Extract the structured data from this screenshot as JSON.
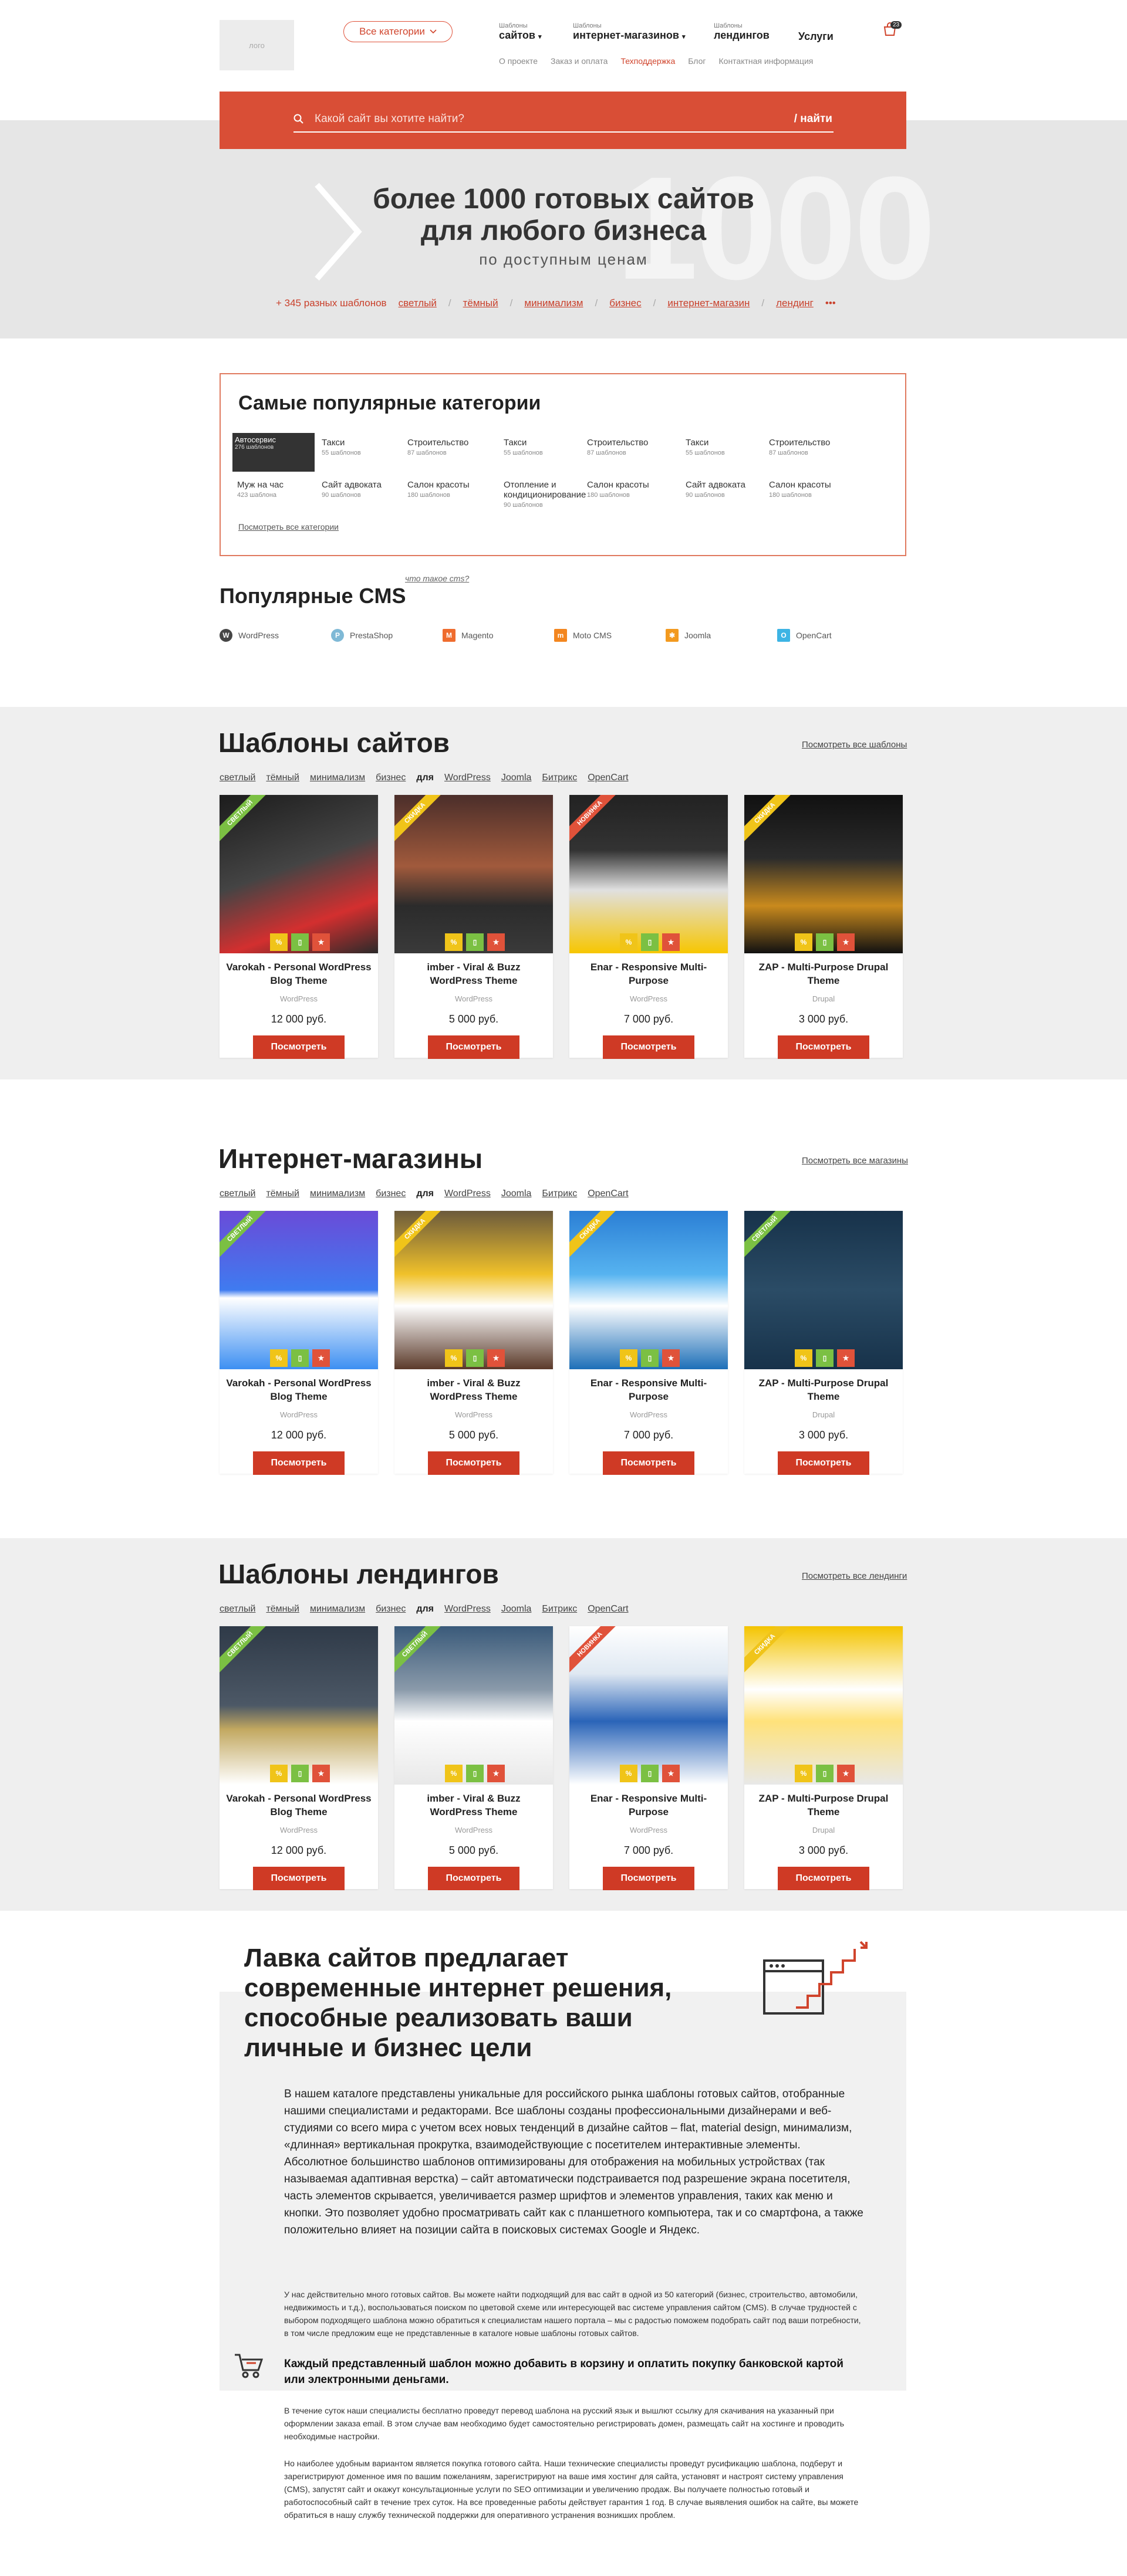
{
  "header": {
    "logo_text": "лого",
    "all_categories": "Все категории",
    "nav": [
      {
        "small": "Шаблоны",
        "big": "сайтов"
      },
      {
        "small": "Шаблоны",
        "big": "интернет-магазинов"
      },
      {
        "small": "Шаблоны",
        "big": "лендингов"
      },
      {
        "small": "",
        "big": "Услуги"
      }
    ],
    "cart_count": "23",
    "subnav": [
      "О проекте",
      "Заказ и оплата",
      "Техподдержка",
      "Блог",
      "Контактная информация"
    ]
  },
  "search": {
    "placeholder": "Какой сайт вы хотите найти?",
    "button": "/ найти"
  },
  "hero": {
    "bg_number": "1000",
    "title": "более 1000 готовых сайтов для любого бизнеса",
    "subtitle": "по доступным ценам",
    "count_link": "+ 345 разных шаблонов",
    "tags": [
      "светлый",
      "тёмный",
      "минимализм",
      "бизнес",
      "интернет-магазин",
      "лендинг"
    ],
    "more": "•••"
  },
  "popular": {
    "title": "Самые популярные категории",
    "thumb_label": "Автосервис",
    "thumb_count": "276 шаблонов",
    "items_row1": [
      {
        "name": "Такси",
        "count": "55 шаблонов"
      },
      {
        "name": "Строительство",
        "count": "87 шаблонов"
      },
      {
        "name": "Такси",
        "count": "55 шаблонов"
      },
      {
        "name": "Строительство",
        "count": "87 шаблонов"
      },
      {
        "name": "Такси",
        "count": "55 шаблонов"
      },
      {
        "name": "Строительство",
        "count": "87 шаблонов"
      }
    ],
    "items_row2": [
      {
        "name": "Муж на час",
        "count": "423 шаблона"
      },
      {
        "name": "Сайт адвоката",
        "count": "90 шаблонов"
      },
      {
        "name": "Салон красоты",
        "count": "180 шаблонов"
      },
      {
        "name": "Отопление и кондиционирование",
        "count": "90 шаблонов"
      },
      {
        "name": "Салон красоты",
        "count": "180 шаблонов"
      },
      {
        "name": "Сайт адвоката",
        "count": "90 шаблонов"
      },
      {
        "name": "Салон красоты",
        "count": "180 шаблонов"
      }
    ],
    "all_link": "Посмотреть все категории"
  },
  "cms": {
    "title": "Популярные CMS",
    "what": "что такое cms?",
    "items": [
      {
        "name": "WordPress",
        "icon": "wordpress-icon",
        "color": "#464646"
      },
      {
        "name": "PrestaShop",
        "icon": "prestashop-icon",
        "color": "#7fb9d6"
      },
      {
        "name": "Magento",
        "icon": "magento-icon",
        "color": "#ef6c2e"
      },
      {
        "name": "Moto CMS",
        "icon": "motocms-icon",
        "color": "#f3861f"
      },
      {
        "name": "Joomla",
        "icon": "joomla-icon",
        "color": "#f39a1f"
      },
      {
        "name": "OpenCart",
        "icon": "opencart-icon",
        "color": "#3db4e4"
      }
    ]
  },
  "filters": [
    "светлый",
    "тёмный",
    "минимализм",
    "бизнес"
  ],
  "filter_for": "для",
  "filter_cms": [
    "WordPress",
    "Joomla",
    "Битрикс",
    "OpenCart"
  ],
  "button_label": "Посмотреть",
  "sections": [
    {
      "title": "Шаблоны сайтов",
      "all": "Посмотреть все шаблоны",
      "cards": [
        {
          "ribbon": "СВЕТЛЫЙ",
          "ribbon_color": "#7bc043",
          "name": "Varokah - Personal WordPress Blog Theme",
          "cms": "WordPress",
          "price": "12 000 руб."
        },
        {
          "ribbon": "СКИДКА",
          "ribbon_color": "#f0c419",
          "name": "imber - Viral & Buzz WordPress Theme",
          "cms": "WordPress",
          "price": "5 000 руб."
        },
        {
          "ribbon": "НОВИНКА",
          "ribbon_color": "#e0523a",
          "name": "Enar - Responsive Multi-Purpose",
          "cms": "WordPress",
          "price": "7 000 руб."
        },
        {
          "ribbon": "СКИДКА",
          "ribbon_color": "#f0c419",
          "name": "ZAP - Multi-Purpose Drupal Theme",
          "cms": "Drupal",
          "price": "3 000 руб."
        }
      ]
    },
    {
      "title": "Интернет-магазины",
      "all": "Посмотреть все магазины",
      "cards": [
        {
          "ribbon": "СВЕТЛЫЙ",
          "ribbon_color": "#7bc043",
          "name": "Varokah - Personal WordPress Blog Theme",
          "cms": "WordPress",
          "price": "12 000 руб."
        },
        {
          "ribbon": "СКИДКА",
          "ribbon_color": "#f0c419",
          "name": "imber - Viral & Buzz WordPress Theme",
          "cms": "WordPress",
          "price": "5 000 руб."
        },
        {
          "ribbon": "СКИДКА",
          "ribbon_color": "#f0c419",
          "name": "Enar - Responsive Multi-Purpose",
          "cms": "WordPress",
          "price": "7 000 руб."
        },
        {
          "ribbon": "СВЕТЛЫЙ",
          "ribbon_color": "#7bc043",
          "name": "ZAP - Multi-Purpose Drupal Theme",
          "cms": "Drupal",
          "price": "3 000 руб."
        }
      ]
    },
    {
      "title": "Шаблоны лендингов",
      "all": "Посмотреть все лендинги",
      "cards": [
        {
          "ribbon": "СВЕТЛЫЙ",
          "ribbon_color": "#7bc043",
          "name": "Varokah - Personal WordPress Blog Theme",
          "cms": "WordPress",
          "price": "12 000 руб."
        },
        {
          "ribbon": "СВЕТЛЫЙ",
          "ribbon_color": "#7bc043",
          "name": "imber - Viral & Buzz WordPress Theme",
          "cms": "WordPress",
          "price": "5 000 руб."
        },
        {
          "ribbon": "НОВИНКА",
          "ribbon_color": "#e0523a",
          "name": "Enar - Responsive Multi-Purpose",
          "cms": "WordPress",
          "price": "7 000 руб."
        },
        {
          "ribbon": "СКИДКА",
          "ribbon_color": "#f0c419",
          "name": "ZAP - Multi-Purpose Drupal Theme",
          "cms": "Drupal",
          "price": "3 000 руб."
        }
      ]
    }
  ],
  "about": {
    "title": "Лавка сайтов предлагает современные интернет решения, способные реализовать ваши личные и бизнес цели",
    "lead": "В нашем каталоге представлены уникальные для российского рынка шаблоны готовых сайтов, отобранные нашими специалистами и редакторами. Все шаблоны созданы профессиональными дизайнерами и веб-студиями со всего мира с учетом всех новых тенденций в дизайне сайтов – flat, material design, минимализм, «длинная» вертикальная прокрутка, взаимодействующие с посетителем интерактивные элементы. Абсолютное большинство шаблонов оптимизированы для отображения на мобильных устройствах (так называемая адаптивная верстка) – сайт автоматически подстраивается под разрешение экрана посетителя, часть элементов скрывается, увеличивается размер шрифтов и элементов управления, таких как меню и кнопки. Это позволяет удобно просматривать сайт как с планшетного компьютера, так и со смартфона, а также положительно влияет на позиции сайта в поисковых системах Google и Яндекс.",
    "p2": "У нас действительно много готовых сайтов. Вы можете найти подходящий для вас сайт в одной из 50 категорий (бизнес, строительство, автомобили, недвижимость и т.д.), воспользоваться поиском по цветовой схеме или интересующей вас системе управления сайтом (CMS). В случае трудностей с выбором подходящего шаблона можно обратиться к специалистам нашего портала – мы с радостью поможем подобрать сайт под ваши потребности, в том числе предложим еще не представленные в каталоге новые шаблоны готовых сайтов.",
    "bold": "Каждый представленный шаблон можно добавить в корзину и оплатить покупку банковской картой или электронными деньгами.",
    "p3": "В течение суток наши специалисты бесплатно проведут перевод шаблона на русский язык и вышлют ссылку для скачивания на указанный при оформлении заказа email. В этом случае вам необходимо будет самостоятельно регистрировать домен, размещать сайт на хостинге и проводить необходимые настройки.",
    "p4": "Но наиболее удобным вариантом является покупка готового сайта. Наши технические специалисты проведут русификацию шаблона, подберут и зарегистрируют доменное имя по вашим пожеланиям, зарегистрируют на ваше имя хостинг для сайта, установят и настроят систему управления (CMS), запустят сайт и окажут консультационные услуги по SEO оптимизации и увеличению продаж. Вы получаете полностью готовый и работоспособный сайт в течение трех суток. На все проведенные работы действует гарантия 1 год. В случае выявления ошибок на сайте, вы можете обратиться в нашу службу технической поддержки для оперативного устранения возникших проблем."
  }
}
